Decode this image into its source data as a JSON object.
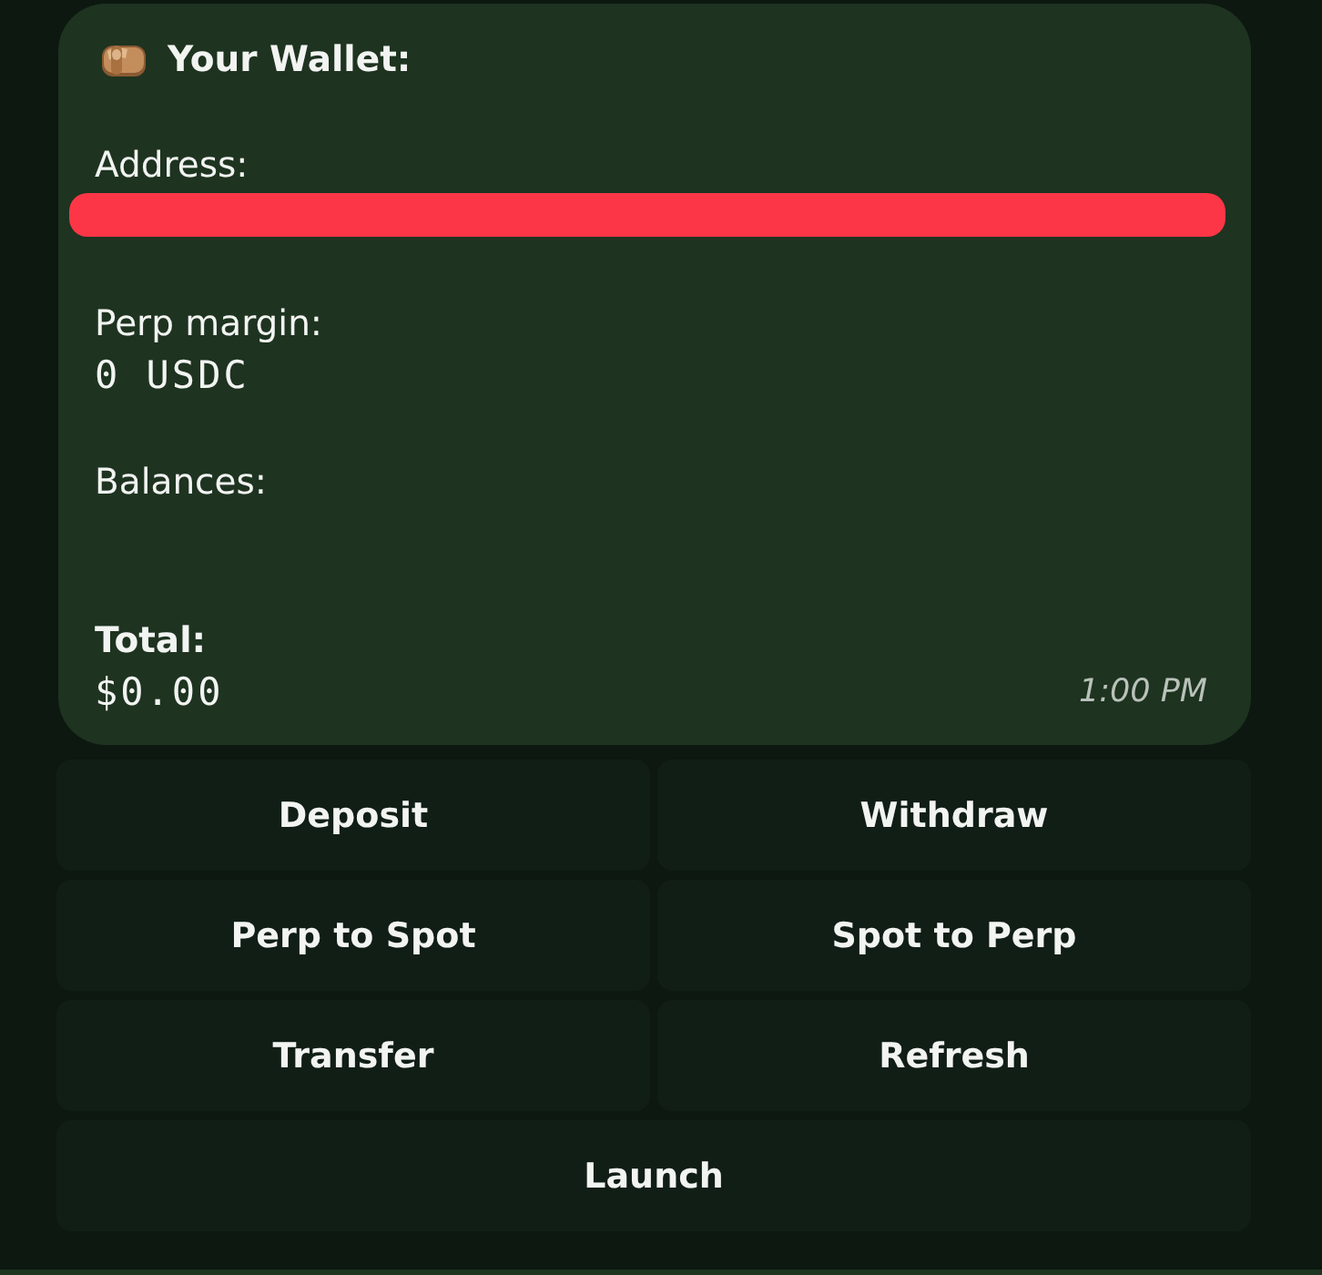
{
  "message": {
    "title": "Your Wallet:",
    "address": {
      "label": "Address:",
      "redacted": true
    },
    "fields": [
      {
        "label": "Perp margin:",
        "value": "0 USDC"
      },
      {
        "label": "Balances:"
      }
    ],
    "total": {
      "label": "Total:",
      "value": "$0.00"
    },
    "time": "1:00 PM"
  },
  "keyboard": {
    "rows": [
      {
        "buttons": [
          {
            "label": "Deposit"
          },
          {
            "label": "Withdraw"
          }
        ]
      },
      {
        "buttons": [
          {
            "label": "Perp to Spot"
          },
          {
            "label": "Spot to Perp"
          }
        ]
      },
      {
        "buttons": [
          {
            "label": "Transfer"
          },
          {
            "label": "Refresh"
          }
        ]
      },
      {
        "buttons": [
          {
            "label": "Launch"
          }
        ]
      }
    ]
  }
}
